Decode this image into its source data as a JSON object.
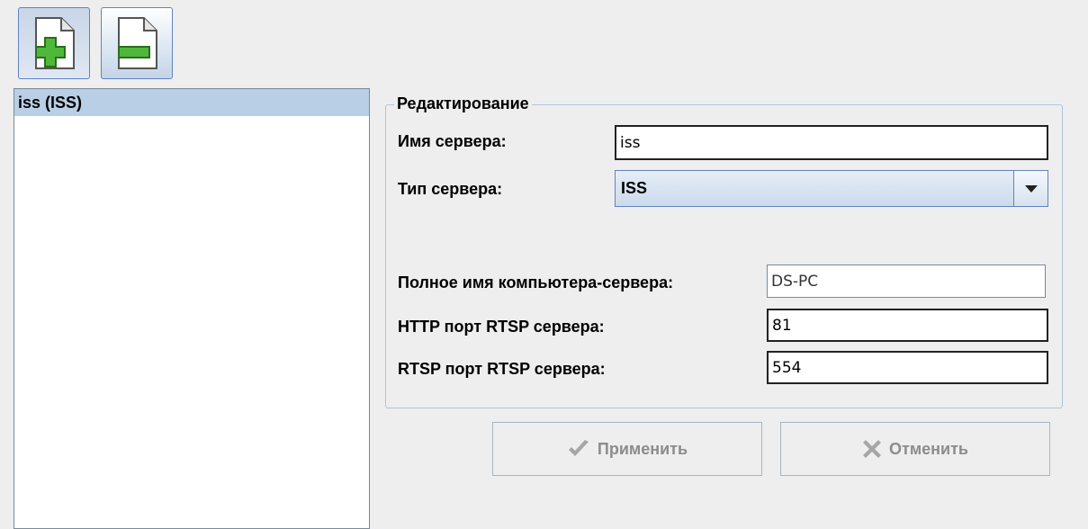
{
  "toolbar": {
    "add_icon": "page-add-icon",
    "remove_icon": "page-remove-icon"
  },
  "server_list": [
    {
      "label": "iss (ISS)",
      "selected": true
    }
  ],
  "edit_group": {
    "title": "Редактирование",
    "server_name_label": "Имя сервера:",
    "server_name_value": "iss",
    "server_type_label": "Тип сервера:",
    "server_type_value": "ISS",
    "hostname_label": "Полное имя компьютера-сервера:",
    "hostname_value": "DS-PC",
    "http_port_label": "HTTP порт RTSP сервера:",
    "http_port_value": "81",
    "rtsp_port_label": "RTSP порт RTSP сервера:",
    "rtsp_port_value": "554"
  },
  "buttons": {
    "apply_label": "Применить",
    "apply_icon": "checkmark-icon",
    "cancel_label": "Отменить",
    "cancel_icon": "cross-icon"
  },
  "colors": {
    "selection": "#b8cfe5",
    "accent_border": "#6382bf",
    "disabled_text": "#8c8c8c"
  }
}
